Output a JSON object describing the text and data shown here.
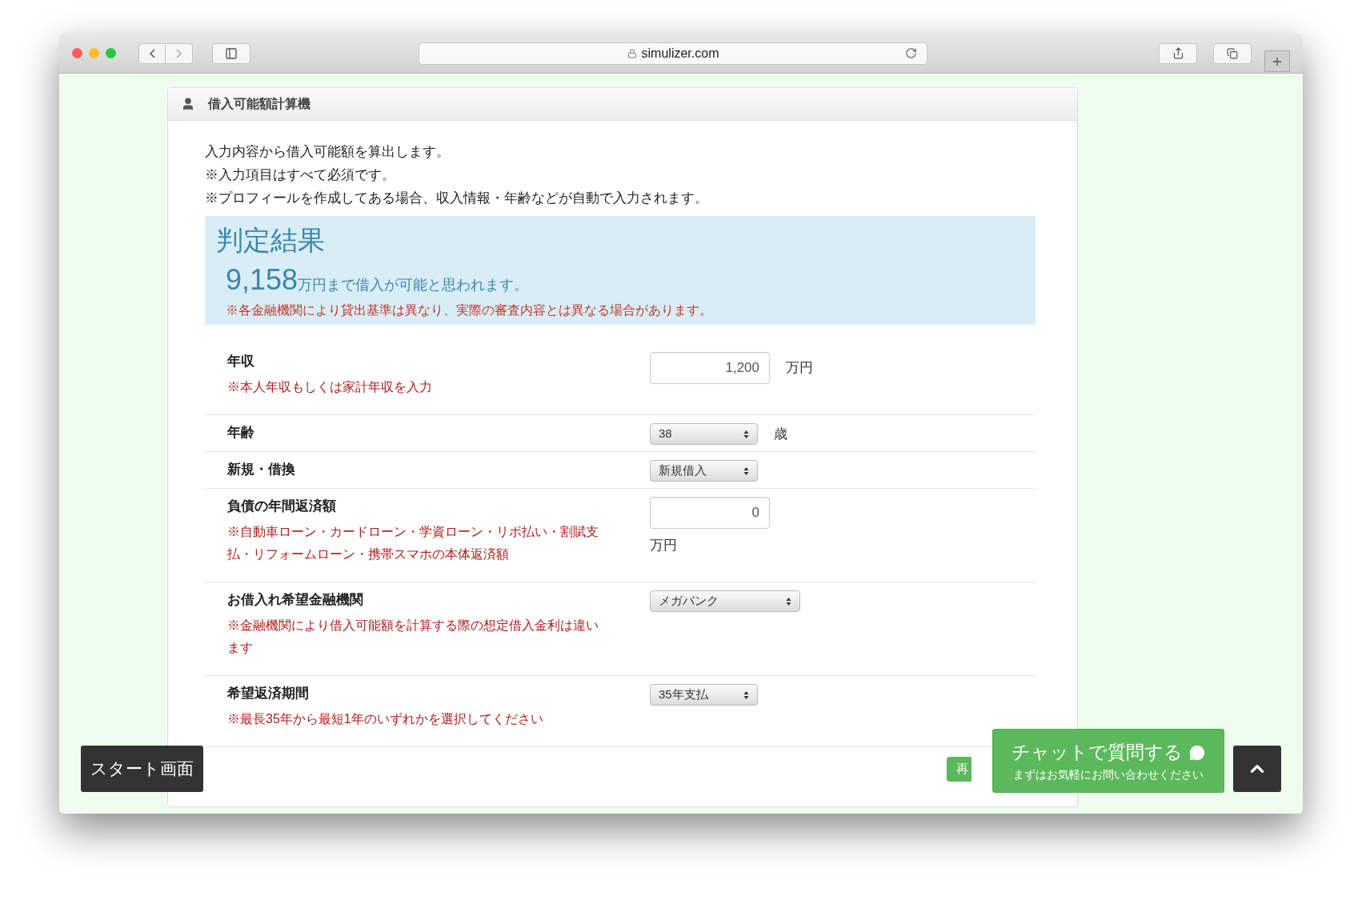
{
  "browser": {
    "url": "simulizer.com"
  },
  "panel": {
    "title": "借入可能額計算機",
    "intro": [
      "入力内容から借入可能額を算出します。",
      "※入力項目はすべて必須です。",
      "※プロフィールを作成してある場合、収入情報・年齢などが自動で入力されます。"
    ],
    "result": {
      "heading": "判定結果",
      "amount": "9,158",
      "amount_text": "万円まで借入が可能と思われます。",
      "note": "※各金融機関により貸出基準は異なり、実際の審査内容とは異なる場合があります。"
    },
    "fields": [
      {
        "kind": "input",
        "label": "年収",
        "note": "※本人年収もしくは家計年収を入力",
        "value": "1,200",
        "unit": "万円",
        "unit_below": false
      },
      {
        "kind": "select",
        "label": "年齢",
        "value": "38",
        "unit": "歳",
        "wide": false
      },
      {
        "kind": "select",
        "label": "新規・借換",
        "value": "新規借入",
        "wide": false
      },
      {
        "kind": "input",
        "label": "負債の年間返済額",
        "note": "※自動車ローン・カードローン・学資ローン・リボ払い・割賦支払・リフォームローン・携帯スマホの本体返済額",
        "value": "0",
        "unit": "万円",
        "unit_below": true
      },
      {
        "kind": "select",
        "label": "お借入れ希望金融機関",
        "note": "※金融機関により借入可能額を計算する際の想定借入金利は違います",
        "value": "メガバンク",
        "wide": true
      },
      {
        "kind": "select",
        "label": "希望返済期間",
        "note": "※最長35年から最短1年のいずれかを選択してください",
        "value": "35年支払",
        "wide": false
      }
    ],
    "partial_button": "再"
  },
  "start_button": "スタート画面",
  "chat": {
    "title": "チャットで質問する",
    "subtitle": "まずはお気軽にお問い合わせください"
  }
}
